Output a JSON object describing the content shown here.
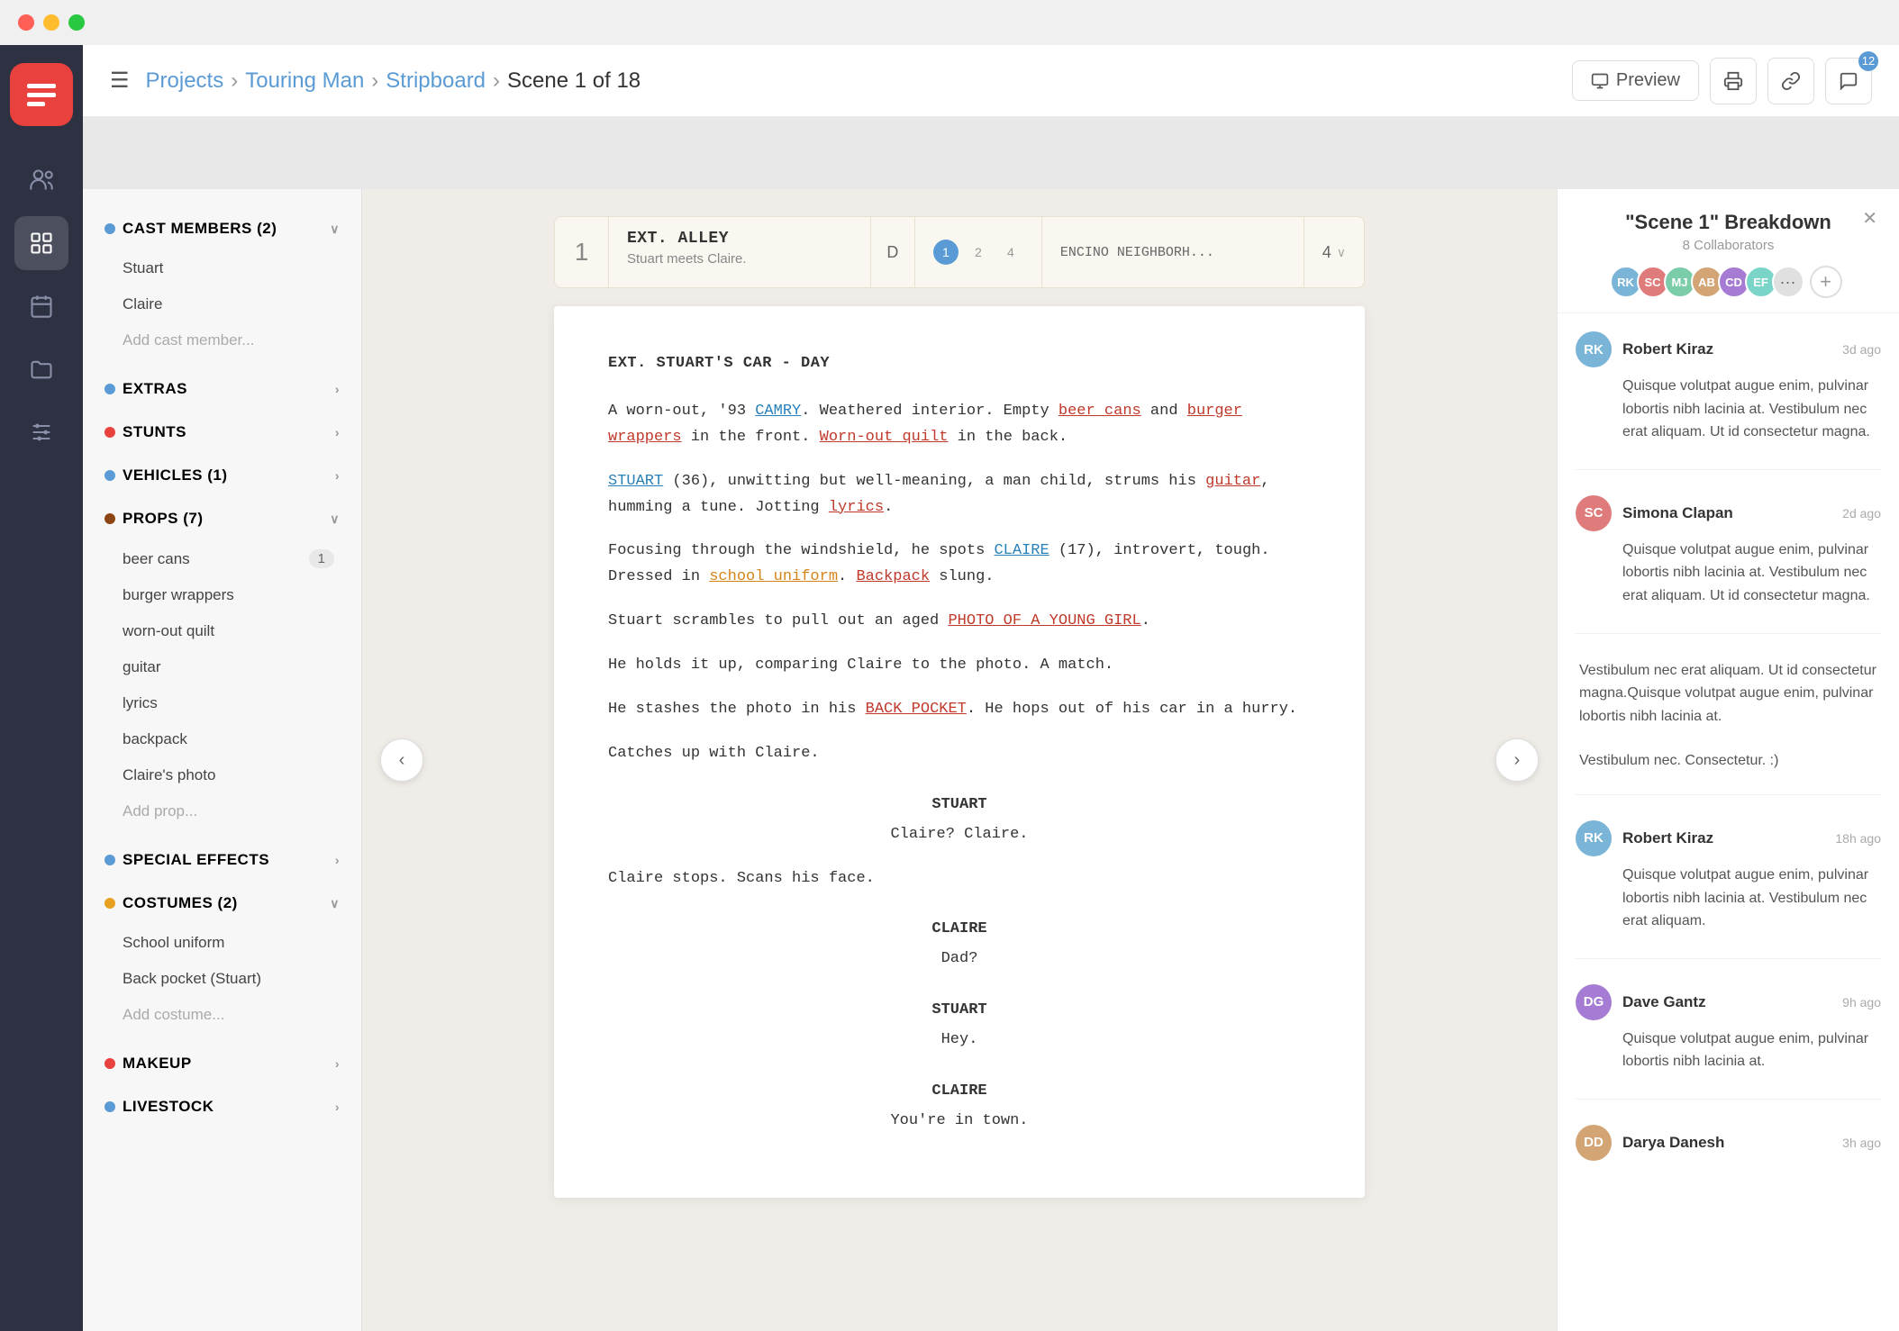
{
  "titlebar": {
    "dots": [
      "red",
      "yellow",
      "green"
    ]
  },
  "header": {
    "menu_label": "☰",
    "breadcrumb": {
      "projects": "Projects",
      "touring_man": "Touring Man",
      "stripboard": "Stripboard",
      "current": "Scene 1 of 18"
    },
    "preview_btn": "Preview",
    "badge_count": "12"
  },
  "breakdown_panel": {
    "categories": [
      {
        "name": "CAST MEMBERS (2)",
        "color": "#5b9bd5",
        "expanded": true,
        "items": [
          {
            "label": "Stuart",
            "count": null
          },
          {
            "label": "Claire",
            "count": null
          }
        ],
        "add_label": "Add cast member..."
      },
      {
        "name": "EXTRAS",
        "color": "#5b9bd5",
        "expanded": false,
        "items": [],
        "add_label": null
      },
      {
        "name": "STUNTS",
        "color": "#e8413e",
        "expanded": false,
        "items": [],
        "add_label": null
      },
      {
        "name": "VEHICLES (1)",
        "color": "#5b9bd5",
        "expanded": false,
        "items": [],
        "add_label": null
      },
      {
        "name": "PROPS (7)",
        "color": "#8B4513",
        "expanded": true,
        "items": [
          {
            "label": "beer cans",
            "count": "1"
          },
          {
            "label": "burger wrappers",
            "count": null
          },
          {
            "label": "worn-out quilt",
            "count": null
          },
          {
            "label": "guitar",
            "count": null
          },
          {
            "label": "lyrics",
            "count": null
          },
          {
            "label": "backpack",
            "count": null
          },
          {
            "label": "Claire's photo",
            "count": null
          }
        ],
        "add_label": "Add prop..."
      },
      {
        "name": "SPECIAL EFFECTS",
        "color": "#5b9bd5",
        "expanded": false,
        "items": [],
        "add_label": null
      },
      {
        "name": "COSTUMES (2)",
        "color": "#e8a020",
        "expanded": true,
        "items": [
          {
            "label": "School uniform",
            "count": null
          },
          {
            "label": "Back pocket (Stuart)",
            "count": null
          }
        ],
        "add_label": "Add costume..."
      },
      {
        "name": "MAKEUP",
        "color": "#e8413e",
        "expanded": false,
        "items": [],
        "add_label": null
      },
      {
        "name": "LIVESTOCK",
        "color": "#5b9bd5",
        "expanded": false,
        "items": [],
        "add_label": null
      }
    ]
  },
  "scene_card": {
    "number": "1",
    "title": "EXT. ALLEY",
    "subtitle": "Stuart meets Claire.",
    "day_indicator": "D",
    "pages": [
      "1",
      "2",
      "4"
    ],
    "active_page": "1",
    "location": "ENCINO NEIGHBORH...",
    "duration": "4"
  },
  "script": {
    "heading": "EXT. STUART'S CAR - DAY",
    "paragraphs": [
      {
        "type": "action",
        "parts": [
          {
            "text": "A worn-out, '93 ",
            "style": "normal"
          },
          {
            "text": "CAMRY",
            "style": "cast"
          },
          {
            "text": ". Weathered interior. Empty ",
            "style": "normal"
          },
          {
            "text": "beer cans",
            "style": "prop"
          },
          {
            "text": " and ",
            "style": "normal"
          },
          {
            "text": "burger wrappers",
            "style": "prop"
          },
          {
            "text": " in the front. ",
            "style": "normal"
          },
          {
            "text": "Worn-out quilt",
            "style": "prop"
          },
          {
            "text": " in the back.",
            "style": "normal"
          }
        ]
      },
      {
        "type": "action",
        "parts": [
          {
            "text": "STUART",
            "style": "cast"
          },
          {
            "text": " (36), unwitting but well-meaning, a man child, strums his ",
            "style": "normal"
          },
          {
            "text": "guitar",
            "style": "prop"
          },
          {
            "text": ", humming a tune. Jotting ",
            "style": "normal"
          },
          {
            "text": "lyrics",
            "style": "prop"
          },
          {
            "text": ".",
            "style": "normal"
          }
        ]
      },
      {
        "type": "action",
        "parts": [
          {
            "text": "Focusing through the windshield, he spots ",
            "style": "normal"
          },
          {
            "text": "CLAIRE",
            "style": "cast"
          },
          {
            "text": " (17), introvert, tough. Dressed in ",
            "style": "normal"
          },
          {
            "text": "school uniform",
            "style": "costume"
          },
          {
            "text": ". ",
            "style": "normal"
          },
          {
            "text": "Backpack",
            "style": "prop"
          },
          {
            "text": " slung.",
            "style": "normal"
          }
        ]
      },
      {
        "type": "action",
        "parts": [
          {
            "text": "Stuart scrambles to pull out an aged ",
            "style": "normal"
          },
          {
            "text": "PHOTO OF A YOUNG GIRL",
            "style": "prop"
          },
          {
            "text": ".",
            "style": "normal"
          }
        ]
      },
      {
        "type": "action",
        "parts": [
          {
            "text": "He holds it up, comparing Claire to the photo. A match.",
            "style": "normal"
          }
        ]
      },
      {
        "type": "action",
        "parts": [
          {
            "text": "He stashes the photo in his ",
            "style": "normal"
          },
          {
            "text": "BACK POCKET",
            "style": "prop"
          },
          {
            "text": ". He hops out of his car in a hurry.",
            "style": "normal"
          }
        ]
      },
      {
        "type": "action",
        "parts": [
          {
            "text": "Catches up with Claire.",
            "style": "normal"
          }
        ]
      },
      {
        "type": "character",
        "text": "STUART"
      },
      {
        "type": "dialogue",
        "text": "Claire? Claire."
      },
      {
        "type": "action",
        "parts": [
          {
            "text": "Claire stops. Scans his face.",
            "style": "normal"
          }
        ]
      },
      {
        "type": "character",
        "text": "CLAIRE"
      },
      {
        "type": "dialogue",
        "text": "Dad?"
      },
      {
        "type": "character",
        "text": "STUART"
      },
      {
        "type": "dialogue",
        "text": "Hey."
      },
      {
        "type": "character",
        "text": "CLAIRE"
      },
      {
        "type": "dialogue",
        "text": "You're in town."
      }
    ]
  },
  "comments_panel": {
    "title": "\"Scene 1\" Breakdown",
    "collaborators_count": "8 Collaborators",
    "collaborators": [
      {
        "initials": "RK",
        "color": "#7ab5d8"
      },
      {
        "initials": "SC",
        "color": "#e07b7b"
      },
      {
        "initials": "MJ",
        "color": "#7bcca8"
      },
      {
        "initials": "AB",
        "color": "#d4a574"
      },
      {
        "initials": "CD",
        "color": "#a57bd4"
      },
      {
        "initials": "EF",
        "color": "#7bd4c8"
      }
    ],
    "comments": [
      {
        "author": "Robert Kiraz",
        "time": "3d ago",
        "avatar_color": "#7ab5d8",
        "initials": "RK",
        "text": "Quisque volutpat augue enim, pulvinar lobortis nibh lacinia at. Vestibulum nec erat aliquam. Ut id consectetur magna."
      },
      {
        "author": "Simona Clapan",
        "time": "2d ago",
        "avatar_color": "#e07b7b",
        "initials": "SC",
        "text": "Quisque volutpat augue enim, pulvinar lobortis nibh lacinia at. Vestibulum nec erat aliquam. Ut id consectetur magna."
      },
      {
        "standalone_1": "Vestibulum nec erat aliquam. Ut id consectetur magna.Quisque volutpat augue enim, pulvinar lobortis nibh lacinia at.",
        "standalone_2": "Vestibulum nec. Consectetur. :)"
      },
      {
        "author": "Robert Kiraz",
        "time": "18h ago",
        "avatar_color": "#7ab5d8",
        "initials": "RK",
        "text": "Quisque volutpat augue enim, pulvinar lobortis nibh lacinia at. Vestibulum nec erat aliquam."
      },
      {
        "author": "Dave Gantz",
        "time": "9h ago",
        "avatar_color": "#a57bd4",
        "initials": "DG",
        "text": "Quisque volutpat augue enim, pulvinar lobortis nibh lacinia at."
      },
      {
        "author": "Darya Danesh",
        "time": "3h ago",
        "avatar_color": "#d4a574",
        "initials": "DD",
        "text": ""
      }
    ]
  }
}
